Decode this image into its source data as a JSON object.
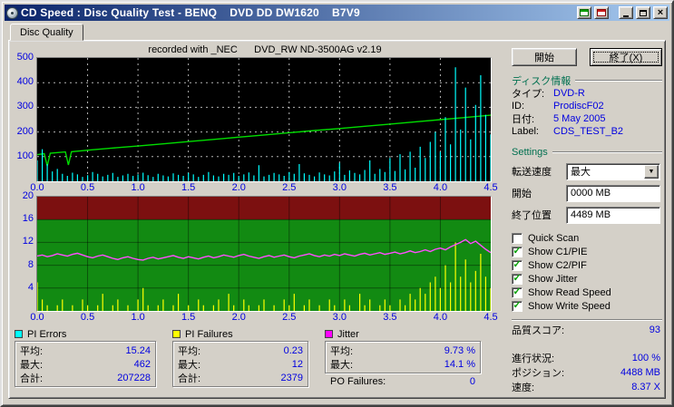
{
  "titlebar": {
    "title": "CD Speed : Disc Quality Test - BENQ    DVD DD DW1620    B7V9"
  },
  "tabs": [
    {
      "label": "Disc Quality"
    }
  ],
  "chart_data": [
    {
      "type": "line",
      "title": "recorded with _NEC      DVD_RW ND-3500AG v2.19",
      "x_range": [
        0,
        4.5
      ],
      "y_range": [
        0,
        500
      ],
      "x_ticks": [
        "0.0",
        "0.5",
        "1.0",
        "1.5",
        "2.0",
        "2.5",
        "3.0",
        "3.5",
        "4.0",
        "4.5"
      ],
      "y_ticks": [
        500,
        400,
        300,
        200,
        100
      ],
      "background": "#000000",
      "grid": {
        "x_step": 0.5,
        "y_step": 100,
        "color": "rgba(255,255,255,0.7)",
        "dash": "2,4"
      },
      "series": [
        {
          "name": "Read Speed",
          "render": "line",
          "color": "#00dd00",
          "points": [
            [
              0,
              108
            ],
            [
              0.07,
              112
            ],
            [
              0.1,
              62
            ],
            [
              0.13,
              114
            ],
            [
              0.28,
              119
            ],
            [
              0.31,
              66
            ],
            [
              0.34,
              120
            ],
            [
              0.5,
              126
            ],
            [
              0.75,
              135
            ],
            [
              1.0,
              143
            ],
            [
              1.25,
              152
            ],
            [
              1.5,
              161
            ],
            [
              1.75,
              170
            ],
            [
              2.0,
              179
            ],
            [
              2.25,
              188
            ],
            [
              2.5,
              197
            ],
            [
              2.75,
              206
            ],
            [
              3.0,
              214
            ],
            [
              3.25,
              223
            ],
            [
              3.5,
              232
            ],
            [
              3.75,
              241
            ],
            [
              4.0,
              250
            ],
            [
              4.25,
              259
            ],
            [
              4.5,
              268
            ]
          ]
        },
        {
          "name": "PI Errors",
          "render": "spikes",
          "color": "#00ffff",
          "x_step": 0.05,
          "values": [
            85,
            130,
            70,
            40,
            50,
            30,
            22,
            35,
            28,
            18,
            25,
            38,
            30,
            20,
            26,
            34,
            18,
            24,
            30,
            22,
            28,
            35,
            25,
            18,
            30,
            24,
            20,
            32,
            26,
            22,
            34,
            28,
            18,
            26,
            38,
            24,
            20,
            30,
            26,
            34,
            22,
            28,
            36,
            24,
            65,
            20,
            26,
            34,
            28,
            22,
            38,
            30,
            70,
            32,
            26,
            20,
            36,
            28,
            24,
            40,
            75,
            26,
            44,
            34,
            28,
            46,
            85,
            30,
            50,
            38,
            95,
            42,
            110,
            48,
            120,
            55,
            140,
            95,
            160,
            200,
            120,
            260,
            150,
            462,
            210,
            380,
            170,
            310,
            430,
            270,
            190
          ]
        }
      ]
    },
    {
      "type": "line",
      "title": "",
      "x_range": [
        0,
        4.5
      ],
      "y_range": [
        0,
        20
      ],
      "x_ticks": [
        "0.0",
        "0.5",
        "1.0",
        "1.5",
        "2.0",
        "2.5",
        "3.0",
        "3.5",
        "4.0",
        "4.5"
      ],
      "y_ticks": [
        20,
        16,
        12,
        8,
        4
      ],
      "bands": [
        {
          "from": 16,
          "to": 20,
          "color": "#7c1010"
        },
        {
          "from": 0,
          "to": 16,
          "color": "#128a12"
        }
      ],
      "grid": {
        "x_step": 0.5,
        "y_step": 4,
        "color": "rgba(0,0,0,0.40)",
        "dash": ""
      },
      "series": [
        {
          "name": "PI Failures",
          "render": "spikes",
          "color": "#ffff00",
          "x_step": 0.05,
          "values": [
            5,
            2,
            1,
            0,
            1,
            2,
            0,
            1,
            0,
            2,
            1,
            0,
            1,
            3,
            0,
            1,
            2,
            0,
            1,
            0,
            2,
            4,
            1,
            0,
            1,
            2,
            0,
            1,
            3,
            0,
            1,
            0,
            2,
            1,
            0,
            1,
            2,
            0,
            3,
            1,
            0,
            2,
            1,
            0,
            1,
            2,
            0,
            1,
            0,
            2,
            1,
            3,
            0,
            1,
            2,
            0,
            1,
            0,
            2,
            1,
            0,
            2,
            1,
            0,
            3,
            1,
            2,
            0,
            1,
            2,
            1,
            0,
            2,
            1,
            3,
            2,
            4,
            3,
            5,
            6,
            4,
            8,
            5,
            12,
            6,
            9,
            5,
            7,
            10,
            6,
            4
          ]
        },
        {
          "name": "Jitter",
          "render": "line",
          "color": "#ff4dff",
          "x_step": 0.05,
          "values": [
            9.6,
            9.8,
            9.5,
            9.7,
            10.0,
            9.8,
            9.6,
            9.9,
            10.1,
            9.8,
            9.5,
            9.3,
            9.6,
            9.8,
            9.5,
            9.2,
            9.0,
            9.3,
            9.5,
            9.2,
            9.0,
            8.9,
            9.2,
            9.4,
            9.1,
            9.3,
            9.5,
            9.7,
            9.4,
            9.2,
            9.5,
            9.3,
            9.1,
            9.4,
            9.6,
            9.3,
            9.5,
            9.8,
            9.6,
            9.4,
            9.7,
            9.9,
            9.6,
            9.4,
            9.2,
            9.5,
            9.7,
            9.4,
            9.6,
            9.8,
            9.5,
            9.3,
            9.6,
            9.8,
            10.0,
            9.7,
            9.5,
            9.8,
            9.6,
            9.9,
            9.7,
            10.0,
            9.8,
            9.6,
            9.9,
            10.1,
            9.8,
            10.0,
            10.2,
            9.9,
            10.1,
            10.3,
            10.0,
            10.2,
            10.5,
            10.2,
            10.4,
            10.7,
            10.4,
            10.8,
            11.0,
            10.7,
            11.2,
            11.6,
            12.0,
            12.5,
            11.8,
            12.2,
            11.5,
            10.8,
            10.2
          ]
        }
      ]
    }
  ],
  "right_panel": {
    "start_button": "開始",
    "exit_button": "終了(X)",
    "disc_info": {
      "header": "ディスク情報",
      "rows": [
        {
          "label": "タイプ:",
          "value": "DVD-R"
        },
        {
          "label": "ID:",
          "value": "ProdiscF02"
        },
        {
          "label": "日付:",
          "value": "5 May 2005"
        },
        {
          "label": "Label:",
          "value": "CDS_TEST_B2"
        }
      ]
    },
    "settings": {
      "header": "Settings",
      "transfer_speed_label": "転送速度",
      "transfer_speed_value": "最大",
      "start_label": "開始",
      "start_value": "0000 MB",
      "end_label": "終了位置",
      "end_value": "4489 MB",
      "checkboxes": [
        {
          "label": "Quick Scan",
          "checked": false,
          "mark": ""
        },
        {
          "label": "Show C1/PIE",
          "checked": true,
          "mark": "✓"
        },
        {
          "label": "Show C2/PIF",
          "checked": true,
          "mark": "✓"
        },
        {
          "label": "Show Jitter",
          "checked": true,
          "mark": "✓"
        },
        {
          "label": "Show Read Speed",
          "checked": true,
          "mark": "✓"
        },
        {
          "label": "Show Write Speed",
          "checked": true,
          "mark": "✓"
        }
      ]
    },
    "quality_score": {
      "label": "品質スコア:",
      "value": "93"
    },
    "progress": {
      "label": "進行状況:",
      "value": "100 %"
    },
    "position": {
      "label": "ポジション:",
      "value": "4488 MB"
    },
    "speed": {
      "label": "速度:",
      "value": "8.37 X"
    }
  },
  "stats": {
    "pi_errors": {
      "title": "PI Errors",
      "color": "#00ffff",
      "rows": [
        {
          "label": "平均:",
          "value": "15.24"
        },
        {
          "label": "最大:",
          "value": "462"
        },
        {
          "label": "合計:",
          "value": "207228"
        }
      ]
    },
    "pi_failures": {
      "title": "PI Failures",
      "color": "#ffff00",
      "rows": [
        {
          "label": "平均:",
          "value": "0.23"
        },
        {
          "label": "最大:",
          "value": "12"
        },
        {
          "label": "合計:",
          "value": "2379"
        }
      ]
    },
    "jitter": {
      "title": "Jitter",
      "color": "#ff00ff",
      "rows": [
        {
          "label": "平均:",
          "value": "9.73 %"
        },
        {
          "label": "最大:",
          "value": "14.1 %"
        }
      ],
      "po_label": "PO Failures:",
      "po_value": "0"
    }
  },
  "colors": {
    "value_text": "#0000e0",
    "check_mark": "#00a000",
    "titlebar_left": "#0a246a",
    "titlebar_right": "#a6caf0",
    "window_bg": "#d4d0c8"
  }
}
